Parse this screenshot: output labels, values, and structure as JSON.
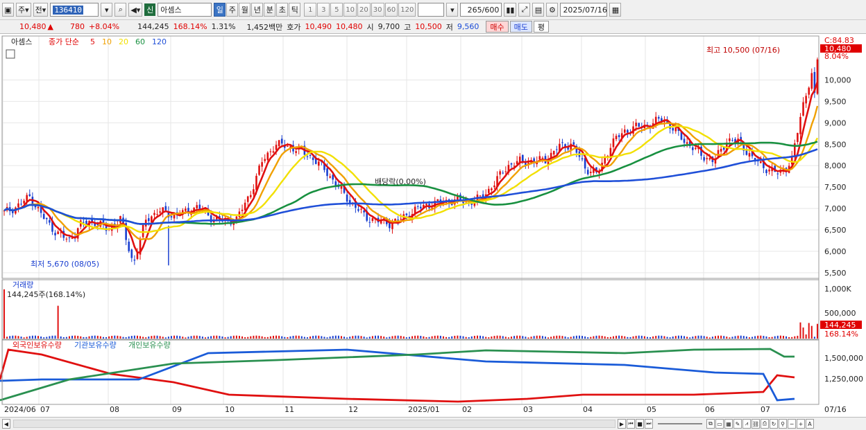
{
  "toolbar": {
    "period_label": "주",
    "compare_label": "전",
    "stock_code": "136410",
    "stock_tag": "신",
    "stock_name": "아셈스",
    "interval_tabs": [
      "일",
      "주",
      "월",
      "년",
      "분",
      "초",
      "틱"
    ],
    "minute_presets": [
      "1",
      "3",
      "5",
      "10",
      "20",
      "30",
      "60",
      "120"
    ],
    "range_value": "265",
    "range_total": "/600",
    "date": "2025/07/16"
  },
  "quote": {
    "price": "10,480",
    "change": "780",
    "change_pct": "+8.04%",
    "volume": "144,245",
    "volume_ratio": "168.14%",
    "turnover": "1.31%",
    "amount": "1,452백만",
    "ask_label": "호가",
    "ask1": "10,490",
    "bid1": "10,480",
    "low_label": "시",
    "open": "9,700",
    "high_label": "고",
    "high": "10,500",
    "low2_label": "저",
    "low": "9,560",
    "buy": "매수",
    "sell": "매도",
    "alt": "평"
  },
  "legend": {
    "stock": "아셈스",
    "ma_label": "종가 단순",
    "ma": [
      {
        "p": "5",
        "c": "#e01010"
      },
      {
        "p": "10",
        "c": "#f0a000"
      },
      {
        "p": "20",
        "c": "#f2e000"
      },
      {
        "p": "60",
        "c": "#189040"
      },
      {
        "p": "120",
        "c": "#1f4fd8"
      }
    ]
  },
  "annotations": {
    "high": "최고 10,500 (07/16)",
    "low": "최저 5,670 (08/05)",
    "dividend": "배당락(0.00%)"
  },
  "price_axis": {
    "ticks": [
      "10,000",
      "9,500",
      "9,000",
      "8,500",
      "8,000",
      "7,500",
      "7,000",
      "6,500",
      "6,000",
      "5,500"
    ],
    "top_label": "C:84.83",
    "last": "10,480",
    "last_pct": "8.04%"
  },
  "volume": {
    "title": "거래량",
    "info": "144,245주(168.14%)",
    "ticks": [
      "1,000K",
      "500,000"
    ],
    "last": "144,245",
    "last_pct": "168.14%"
  },
  "holdings": {
    "legend": [
      "외국인보유수량",
      "기관보유수량",
      "개인보유수량"
    ],
    "ticks": [
      "1,500,000",
      "1,250,000"
    ]
  },
  "x_axis": [
    "2024/06",
    "07",
    "08",
    "09",
    "10",
    "11",
    "12",
    "2025/01",
    "02",
    "03",
    "04",
    "05",
    "06",
    "07"
  ],
  "x_end": "07/16",
  "chart_data": {
    "type": "candlestick",
    "price_range": [
      5400,
      10800
    ],
    "closes_key": [
      6900,
      7050,
      7280,
      6800,
      6450,
      6250,
      6650,
      6700,
      6500,
      6750,
      5700,
      6750,
      6950,
      6850,
      6900,
      7050,
      6800,
      6700,
      6750,
      7300,
      8100,
      8500,
      8450,
      8350,
      8150,
      7850,
      7450,
      7100,
      6800,
      6700,
      6650,
      6800,
      7000,
      7100,
      7150,
      7200,
      7150,
      7250,
      7600,
      8000,
      8100,
      8100,
      8150,
      8450,
      8500,
      7950,
      7800,
      8500,
      8800,
      8900,
      8950,
      9100,
      8800,
      8500,
      8250,
      8100,
      8600,
      8550,
      8150,
      7950,
      7800,
      8100,
      9600,
      10480
    ],
    "volume_spikes": [
      {
        "i": 0,
        "v": 900000
      },
      {
        "i": 19,
        "v": 600000
      },
      {
        "i": 283,
        "v": 950000
      }
    ],
    "series": [
      {
        "name": "외국인보유수량",
        "color": "#e01010"
      },
      {
        "name": "기관보유수량",
        "color": "#1a5bd8"
      },
      {
        "name": "개인보유수량",
        "color": "#2a9050"
      }
    ]
  },
  "colors": {
    "up": "#e01010",
    "down": "#1a3fd0",
    "ma5": "#e01010",
    "ma10": "#f0a000",
    "ma20": "#f2e000",
    "ma60": "#189040",
    "ma120": "#1f4fd8"
  }
}
